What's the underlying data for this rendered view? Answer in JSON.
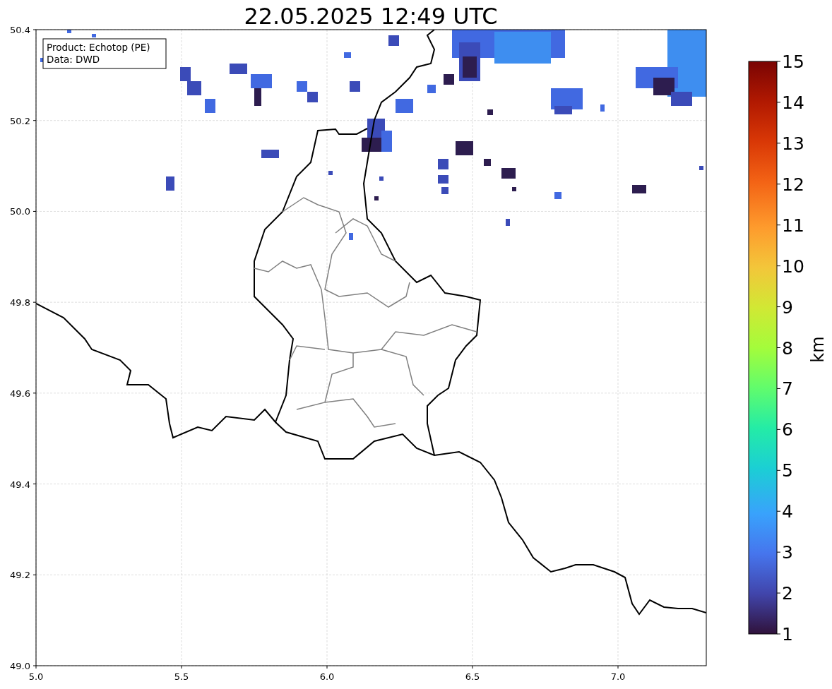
{
  "title": "22.05.2025 12:49 UTC",
  "info_box": {
    "lines": [
      "Product: Echotop (PE)",
      "Data: DWD"
    ]
  },
  "map": {
    "x_tick_labels": [
      "5.0",
      "5.5",
      "6.0",
      "6.5",
      "7.0"
    ],
    "y_tick_labels": [
      "50.4",
      "50.2",
      "50.0",
      "49.8",
      "49.6",
      "49.4",
      "49.2",
      "49.0"
    ]
  },
  "colorbar": {
    "tick_labels": [
      "15",
      "14",
      "13",
      "12",
      "11",
      "10",
      "9",
      "8",
      "7",
      "6",
      "5",
      "4",
      "3",
      "2",
      "1"
    ],
    "label": "km"
  }
}
